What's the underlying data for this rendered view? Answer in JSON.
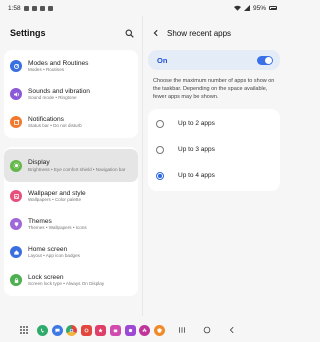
{
  "status_bar": {
    "time": "1:58",
    "battery": "95%"
  },
  "left": {
    "title": "Settings",
    "groups": [
      [
        {
          "title": "Modes and Routines",
          "sub": "Modes • Routines",
          "icon": "modes-icon",
          "color": "#3a6fe0"
        },
        {
          "title": "Sounds and vibration",
          "sub": "Sound mode • Ringtone",
          "icon": "sound-icon",
          "color": "#8b58d8"
        },
        {
          "title": "Notifications",
          "sub": "Status bar • Do not disturb",
          "icon": "notification-icon",
          "color": "#f0792e"
        }
      ],
      [
        {
          "title": "Display",
          "sub": "Brightness • Eye comfort shield • Navigation bar",
          "icon": "display-icon",
          "color": "#64b84a"
        },
        {
          "title": "Wallpaper and style",
          "sub": "Wallpapers • Color palette",
          "icon": "wallpaper-icon",
          "color": "#e6507a"
        },
        {
          "title": "Themes",
          "sub": "Themes • Wallpapers • Icons",
          "icon": "themes-icon",
          "color": "#a067d8"
        },
        {
          "title": "Home screen",
          "sub": "Layout • App icon badges",
          "icon": "home-icon",
          "color": "#3b6fe0"
        },
        {
          "title": "Lock screen",
          "sub": "Screen lock type • Always On Display",
          "icon": "lock-icon",
          "color": "#4caf50"
        }
      ]
    ]
  },
  "right": {
    "title": "Show recent apps",
    "toggle_label": "On",
    "toggle_on": true,
    "description": "Choose the maximum number of apps to show on the taskbar. Depending on the space available, fewer apps may be shown.",
    "options": [
      {
        "label": "Up to 2 apps",
        "checked": false
      },
      {
        "label": "Up to 3 apps",
        "checked": false
      },
      {
        "label": "Up to 4 apps",
        "checked": true
      }
    ]
  },
  "taskbar": {
    "apps": [
      {
        "icon": "phone-app-icon",
        "color": "#2eab6a",
        "shape": "round"
      },
      {
        "icon": "messages-app-icon",
        "color": "#3e78e3",
        "shape": "round"
      },
      {
        "icon": "chrome-app-icon",
        "color": "#f2b53b",
        "shape": "round"
      },
      {
        "icon": "camera-app-icon",
        "color": "#e2463d",
        "shape": "sq"
      },
      {
        "icon": "gallery-app-icon",
        "color": "#df3e69",
        "shape": "sq"
      },
      {
        "icon": "store-app-icon",
        "color": "#d14cb0",
        "shape": "sq"
      },
      {
        "icon": "photos-app-icon",
        "color": "#9d49d5",
        "shape": "sq"
      },
      {
        "icon": "flower-app-icon",
        "color": "#c0359a",
        "shape": "round"
      },
      {
        "icon": "shield-app-icon",
        "color": "#f08a2a",
        "shape": "round"
      }
    ]
  }
}
